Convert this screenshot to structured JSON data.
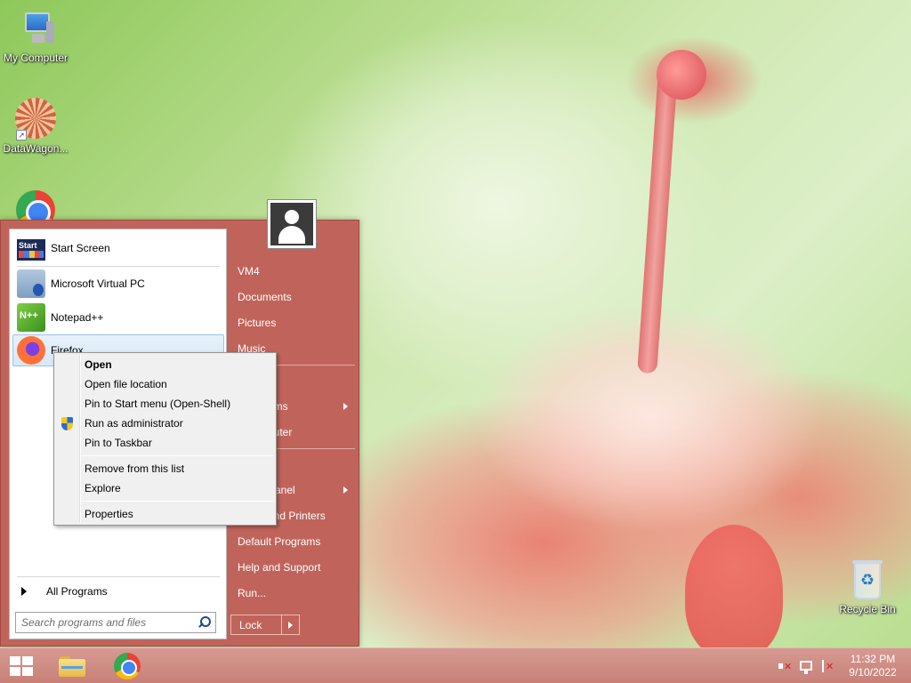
{
  "desktop": {
    "icons": [
      {
        "label": "My Computer"
      },
      {
        "label": "DataWagon..."
      },
      {
        "label": "Google Chrome"
      },
      {
        "label": "Recycle Bin"
      }
    ]
  },
  "start_menu": {
    "programs": [
      {
        "label": "Start Screen",
        "icon": "start-screen-icon"
      },
      {
        "label": "Microsoft Virtual PC",
        "icon": "virtual-pc-icon"
      },
      {
        "label": "Notepad++",
        "icon": "notepadpp-icon"
      },
      {
        "label": "Firefox",
        "icon": "firefox-icon"
      }
    ],
    "all_programs_label": "All Programs",
    "search_placeholder": "Search programs and files",
    "right_items": [
      {
        "label": "VM4"
      },
      {
        "label": "Documents"
      },
      {
        "label": "Pictures"
      },
      {
        "label": "Music"
      },
      {
        "label": "Recent Items",
        "visible_label": "ems"
      },
      {
        "label": "Computer",
        "visible_label": "puter"
      },
      {
        "label": "Control Panel",
        "visible_label": "Panel"
      },
      {
        "label": "Devices and Printers",
        "visible_label": "and Printers"
      },
      {
        "label": "Default Programs"
      },
      {
        "label": "Help and Support"
      },
      {
        "label": "Run..."
      }
    ],
    "lock_label": "Lock"
  },
  "context_menu": {
    "items": [
      {
        "label": "Open",
        "bold": true
      },
      {
        "label": "Open file location"
      },
      {
        "label": "Pin to Start menu (Open-Shell)"
      },
      {
        "label": "Run as administrator",
        "icon": "uac-shield-icon"
      },
      {
        "label": "Pin to Taskbar"
      },
      {
        "label": "Remove from this list"
      },
      {
        "label": "Explore"
      },
      {
        "label": "Properties"
      }
    ]
  },
  "taskbar": {
    "clock_time": "11:32 PM",
    "clock_date": "9/10/2022",
    "pinned": [
      "File Explorer",
      "Google Chrome"
    ]
  },
  "colors": {
    "start_menu_accent": "#c0645b",
    "taskbar": "#c88077"
  }
}
